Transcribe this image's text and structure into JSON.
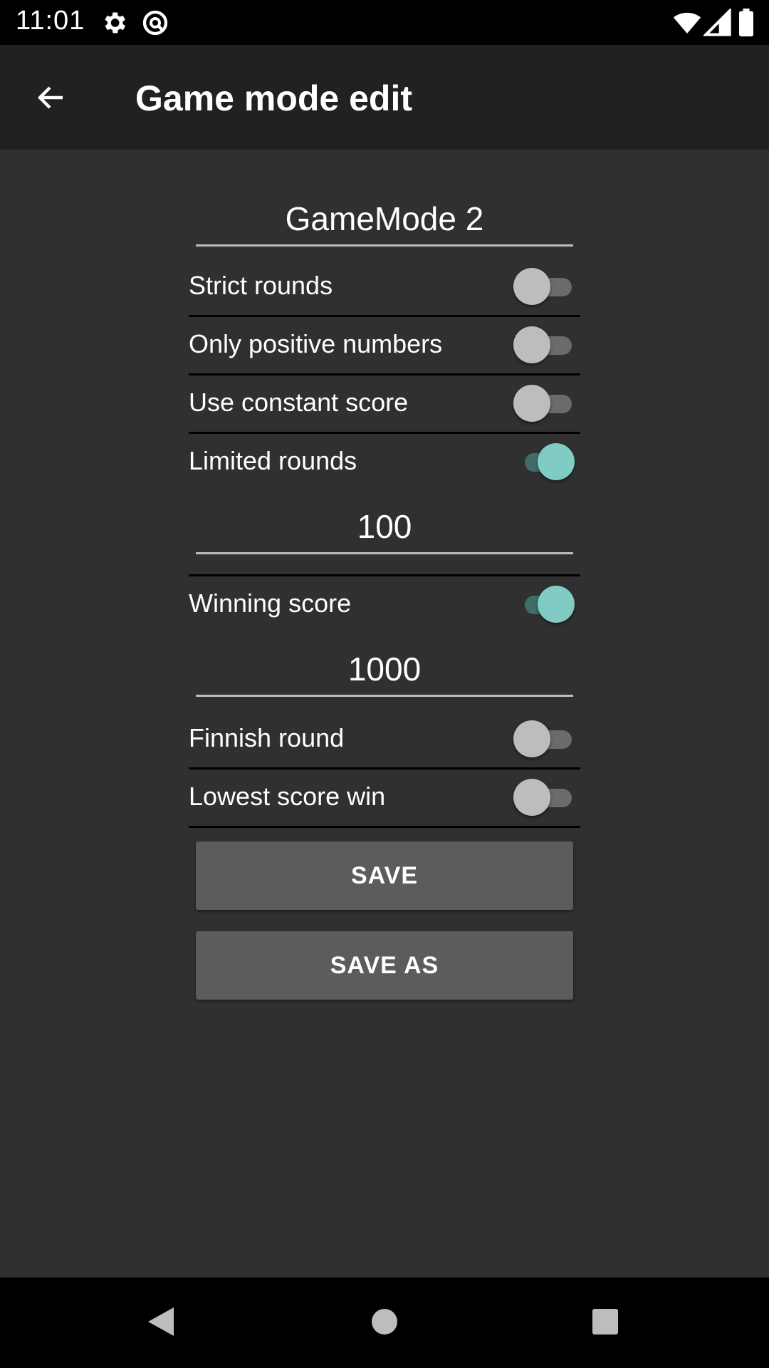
{
  "status_bar": {
    "time": "11:01",
    "icons": [
      "settings-icon",
      "data-saver-icon",
      "wifi-icon",
      "signal-icon",
      "battery-icon"
    ]
  },
  "app_bar": {
    "title": "Game mode edit",
    "back_icon": "arrow-back-icon"
  },
  "form": {
    "mode_name": "GameMode 2",
    "strict_rounds": {
      "label": "Strict rounds",
      "on": false
    },
    "only_positive": {
      "label": "Only positive numbers",
      "on": false
    },
    "constant_score": {
      "label": "Use constant score",
      "on": false
    },
    "limited_rounds": {
      "label": "Limited rounds",
      "on": true,
      "value": "100"
    },
    "winning_score": {
      "label": "Winning score",
      "on": true,
      "value": "1000"
    },
    "finnish_round": {
      "label": "Finnish round",
      "on": false
    },
    "lowest_score_win": {
      "label": "Lowest score win",
      "on": false
    }
  },
  "buttons": {
    "save": "SAVE",
    "save_as": "SAVE AS"
  },
  "colors": {
    "background": "#303030",
    "app_bar": "#212121",
    "accent": "#80cbc4",
    "button": "#5c5c5e"
  },
  "nav_bar": {
    "icons": [
      "back-triangle-icon",
      "home-circle-icon",
      "recents-square-icon"
    ]
  }
}
